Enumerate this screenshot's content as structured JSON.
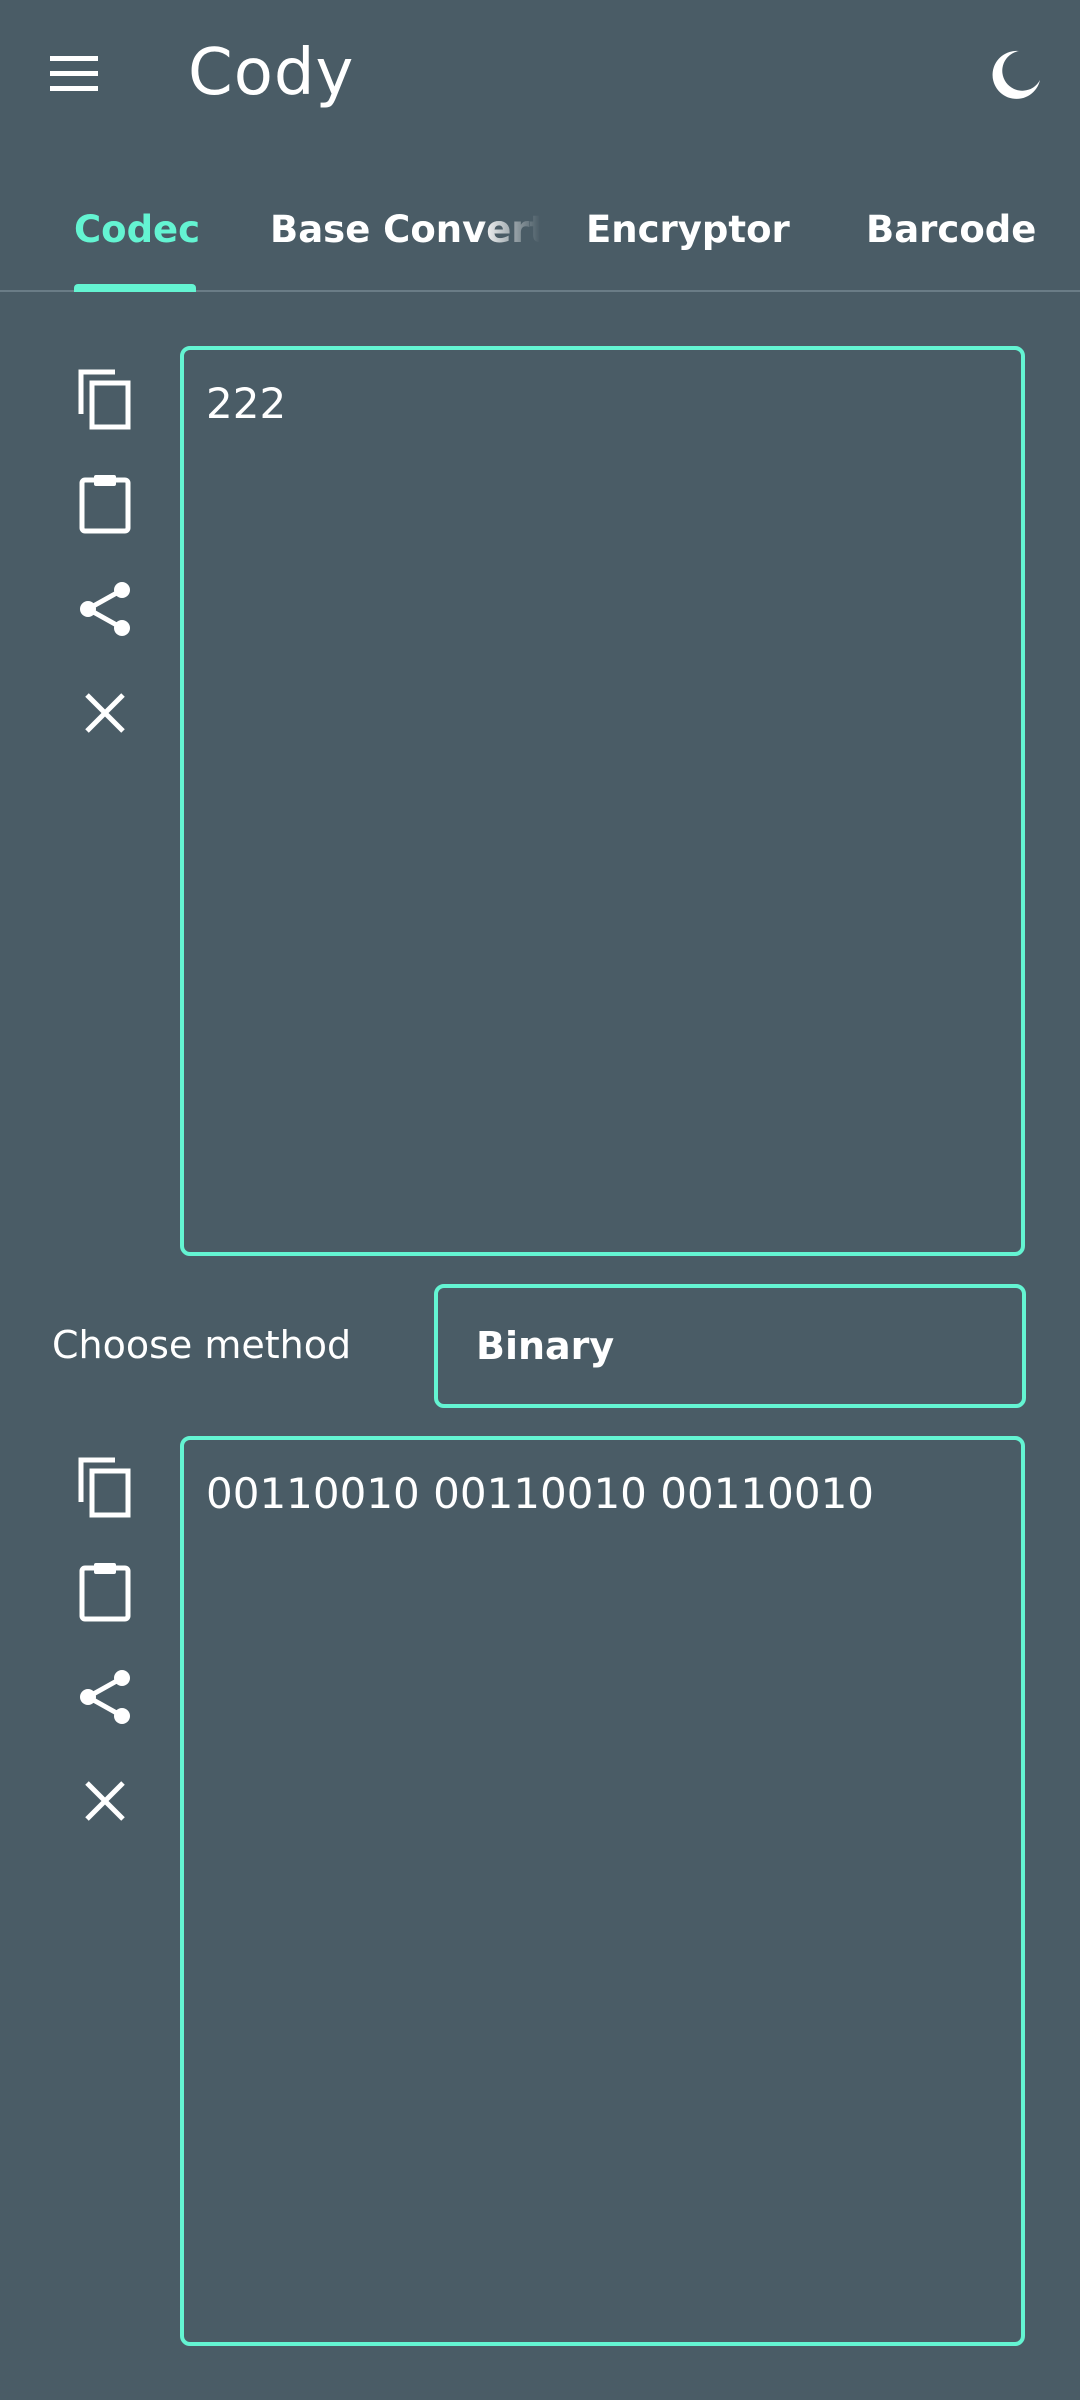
{
  "app": {
    "title": "Cody"
  },
  "icons": {
    "menu": "menu-icon",
    "theme": "moon-icon",
    "copy": "copy-icon",
    "paste": "clipboard-icon",
    "share": "share-icon",
    "clear": "close-icon"
  },
  "tabs": [
    {
      "label": "Codec",
      "active": true
    },
    {
      "label": "Base Converter",
      "active": false
    },
    {
      "label": "Encryptor",
      "active": false
    },
    {
      "label": "Barcode",
      "active": false
    }
  ],
  "input": {
    "value": "222"
  },
  "method": {
    "label": "Choose method",
    "selected": "Binary"
  },
  "output": {
    "value": "00110010 00110010 00110010"
  },
  "colors": {
    "background": "#4a5c66",
    "accent": "#64f4d2",
    "text": "#ffffff"
  }
}
